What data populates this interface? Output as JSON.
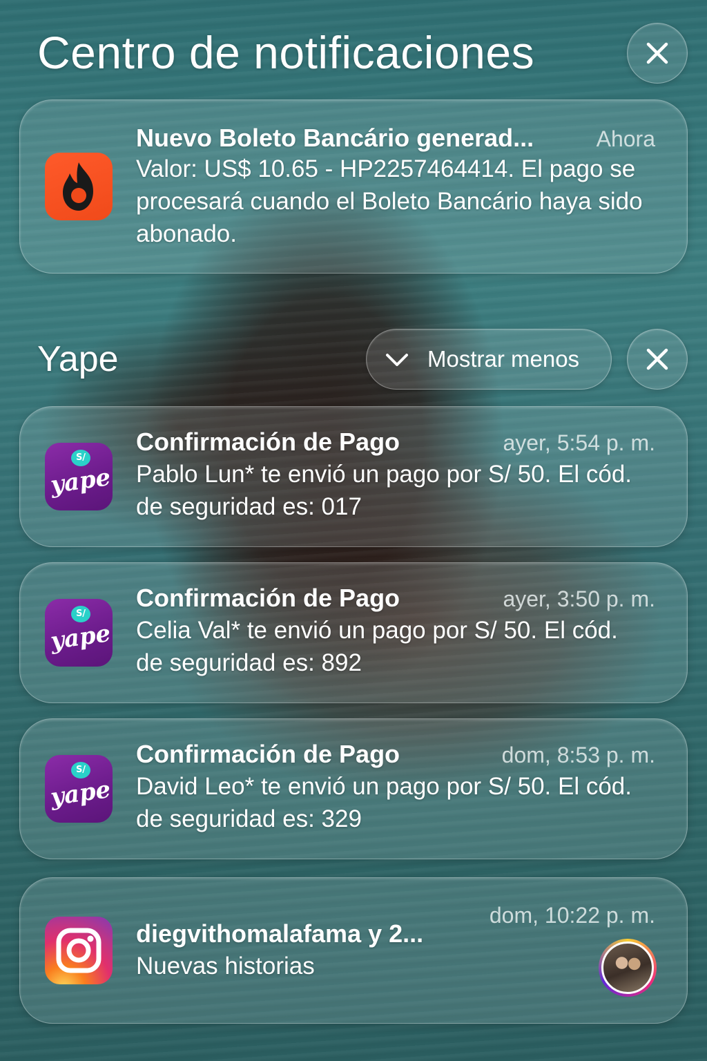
{
  "header": {
    "title": "Centro de notificaciones",
    "close_icon": "close-icon"
  },
  "notifications": [
    {
      "app_icon": "hotmart-flame-icon",
      "title": "Nuevo Boleto Bancário generad...",
      "time": "Ahora",
      "body": "Valor: US$ 10.65 - HP2257464414. El pago se procesará cuando el Boleto Bancário haya sido abonado."
    }
  ],
  "yape_group": {
    "label": "Yape",
    "show_less_label": "Mostrar menos",
    "chevron_icon": "chevron-down-icon",
    "close_icon": "close-icon",
    "icon_text": "yape",
    "icon_badge": "S/",
    "items": [
      {
        "title": "Confirmación de Pago",
        "time": "ayer, 5:54 p. m.",
        "body": "Pablo Lun* te envió un pago por S/ 50. El cód. de seguridad es: 017"
      },
      {
        "title": "Confirmación de Pago",
        "time": "ayer, 3:50 p. m.",
        "body": "Celia Val* te envió un pago por S/ 50. El cód. de seguridad es: 892"
      },
      {
        "title": "Confirmación de Pago",
        "time": "dom, 8:53 p. m.",
        "body": "David Leo* te envió un pago por S/ 50. El cód. de seguridad es: 329"
      }
    ]
  },
  "instagram": {
    "app_icon": "instagram-icon",
    "title": "diegvithomalafama y 2...",
    "time": "dom, 10:22 p. m.",
    "body": "Nuevas historias"
  },
  "colors": {
    "hotmart": "#f04a1a",
    "yape": "#6a1b8a",
    "yape_badge": "#2ad1c9"
  }
}
